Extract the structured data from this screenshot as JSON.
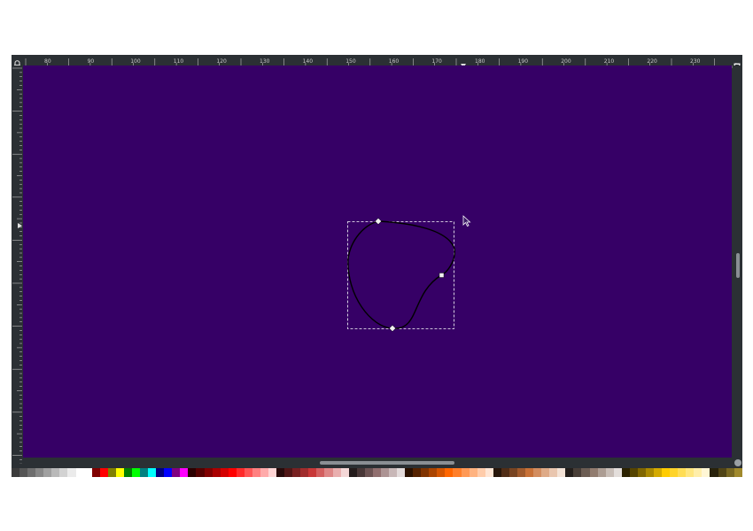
{
  "window": {
    "canvas_color": "#360066",
    "chrome_color": "#2b3034"
  },
  "horizontal_ruler": {
    "labels": [
      "80",
      "90",
      "100",
      "110",
      "120",
      "130",
      "140",
      "150",
      "160",
      "170",
      "180",
      "190",
      "200",
      "210",
      "220",
      "230"
    ]
  },
  "vertical_ruler": {
    "labels": [
      "",
      "",
      "",
      "",
      "",
      "",
      "",
      "",
      ""
    ]
  },
  "canvas": {
    "path": {
      "stroke": "#000000",
      "selection_color": "#ffffff"
    },
    "cursor": "pen-pointer-icon"
  },
  "palette": {
    "swatches": [
      "#3c3c3c",
      "#555555",
      "#6e6e6e",
      "#878787",
      "#a0a0a0",
      "#b9b9b9",
      "#d2d2d2",
      "#ebebeb",
      "#ffffff",
      "#ffffff",
      "#800000",
      "#ff0000",
      "#808000",
      "#ffff00",
      "#008000",
      "#00ff00",
      "#008080",
      "#00ffff",
      "#000080",
      "#0000ff",
      "#800080",
      "#ff00ff",
      "#2b0000",
      "#550000",
      "#800000",
      "#aa0000",
      "#d40000",
      "#ff0000",
      "#ff2a2a",
      "#ff5555",
      "#ff8080",
      "#ffaaaa",
      "#ffd5d5",
      "#280b0b",
      "#501616",
      "#782121",
      "#a02c2c",
      "#c83737",
      "#d35f5f",
      "#de8787",
      "#e9afaf",
      "#f4d7d7",
      "#241c1c",
      "#483737",
      "#6c5353",
      "#916f6f",
      "#ac9393",
      "#c8b7b7",
      "#e3dbdb",
      "#2b1100",
      "#552200",
      "#803300",
      "#aa4400",
      "#d45500",
      "#ff6600",
      "#ff7f2a",
      "#ff9955",
      "#ffb380",
      "#ffccaa",
      "#ffe6d5",
      "#28170b",
      "#502d16",
      "#784421",
      "#a05a2c",
      "#c87137",
      "#d38d5f",
      "#deaa87",
      "#e9c6af",
      "#f4e3d7",
      "#241f1c",
      "#483e37",
      "#6c5d53",
      "#917c6f",
      "#ac9d93",
      "#c8beb7",
      "#e3dedb",
      "#2b2200",
      "#554400",
      "#806600",
      "#aa8800",
      "#d4aa00",
      "#ffcc00",
      "#ffd42a",
      "#ffdd55",
      "#ffe680",
      "#ffeeaa",
      "#fff6d5",
      "#28220b",
      "#504416",
      "#786721",
      "#a0892c"
    ]
  }
}
